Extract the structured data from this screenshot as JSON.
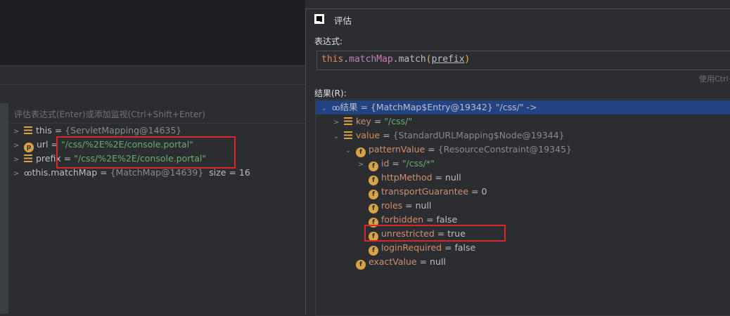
{
  "left_panel": {
    "eval_placeholder": "评估表达式(Enter)或添加监视(Ctrl+Shift+Enter)",
    "variables": [
      {
        "name": "this",
        "eq": " = ",
        "value": "{ServletMapping@14635}",
        "value_type": "ref"
      },
      {
        "name": "url",
        "eq": " = ",
        "value": "\"/css/%2E%2E/console.portal\"",
        "value_type": "string"
      },
      {
        "name": "prefix",
        "eq": " = ",
        "value": "\"/css/%2E%2E/console.portal\"",
        "value_type": "string"
      },
      {
        "name": "this.matchMap",
        "eq": " = ",
        "value": "{MatchMap@14639}",
        "value_type": "ref",
        "extra": "  size = 16"
      }
    ]
  },
  "dialog": {
    "title": "评估",
    "expression_label": "表达式:",
    "expression": {
      "kw": "this",
      "dot1": ".",
      "field": "matchMap",
      "dot2": ".match",
      "lp": "(",
      "param": "prefix",
      "rp": ")"
    },
    "hint": "使用Ctrl+",
    "result_label": "结果(R):",
    "tree": [
      {
        "name": "结果",
        "eq": " = ",
        "value": "{MatchMap$Entry@19342} \"/css/\" ->",
        "extra": ""
      },
      {
        "name": "key",
        "eq": " = ",
        "value": "\"/css/\""
      },
      {
        "name": "value",
        "eq": " = ",
        "value": "{StandardURLMapping$Node@19344}"
      },
      {
        "name": "patternValue",
        "eq": " = ",
        "value": "{ResourceConstraint@19345}"
      },
      {
        "name": "id",
        "eq": " = ",
        "value": "\"/css/*\""
      },
      {
        "name": "httpMethod",
        "eq": " = ",
        "value": "null"
      },
      {
        "name": "transportGuarantee",
        "eq": " = ",
        "value": "0"
      },
      {
        "name": "roles",
        "eq": " = ",
        "value": "null"
      },
      {
        "name": "forbidden",
        "eq": " = ",
        "value": "false"
      },
      {
        "name": "unrestricted",
        "eq": " = ",
        "value": "true"
      },
      {
        "name": "loginRequired",
        "eq": " = ",
        "value": "false"
      },
      {
        "name": "exactValue",
        "eq": " = ",
        "value": "null"
      }
    ]
  },
  "colors": {
    "highlight_box": "#d62828",
    "selection": "#214283",
    "string": "#6aab73",
    "icon": "#d9a343"
  }
}
